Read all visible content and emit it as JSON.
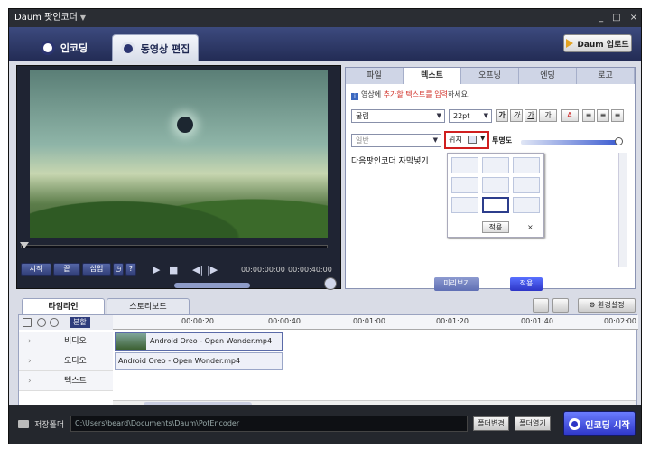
{
  "window": {
    "title": "Daum 팟인코더",
    "controls": [
      "_",
      "□",
      "×"
    ]
  },
  "header": {
    "tabs": [
      {
        "label": "인코딩"
      },
      {
        "label": "동영상 편집"
      }
    ],
    "daum_upload": "Daum 업로드"
  },
  "player": {
    "buttons": {
      "start": "시작",
      "end": "끝",
      "insert": "삽입",
      "help": "?"
    },
    "time_current": "00:00:00:00",
    "time_total": "00:00:40:00",
    "seek_progress": 0
  },
  "editor": {
    "tabs": [
      "파일",
      "텍스트",
      "오프닝",
      "엔딩",
      "로고"
    ],
    "active_tab": "텍스트",
    "hint_pre": "영상에 ",
    "hint_hl": "추가할 텍스트를 입력",
    "hint_post": "하세요.",
    "font": "굴림",
    "size": "22pt",
    "format_buttons": [
      "가",
      "가",
      "가",
      "가"
    ],
    "style": "일반",
    "position_label": "위치",
    "opacity_label": "투명도",
    "text_content": "다음팟인코더 자막넣기",
    "grid_apply": "적용",
    "grid_close": "×",
    "preview_btn": "미리보기",
    "apply_btn": "적용"
  },
  "timeline_tabs": {
    "timeline": "타임라인",
    "storyboard": "스토리보드",
    "settings": "환경설정"
  },
  "timeline": {
    "split": "분할",
    "ruler": [
      "00:00:20",
      "00:00:40",
      "00:01:00",
      "00:01:20",
      "00:01:40",
      "00:02:00"
    ],
    "tracks": [
      "비디오",
      "오디오",
      "텍스트"
    ],
    "video_clip": "Android Oreo - Open Wonder.mp4",
    "audio_clip": "Android Oreo - Open Wonder.mp4"
  },
  "footer": {
    "save_label": "저장폴더",
    "path": "C:\\Users\\beard\\Documents\\Daum\\PotEncoder",
    "change_folder": "폴더변경",
    "open_folder": "폴더열기",
    "encode_start": "인코딩 시작"
  },
  "colors": {
    "accent": "#2d35c6",
    "highlight": "#d01f1f",
    "header": "#2b3470"
  }
}
